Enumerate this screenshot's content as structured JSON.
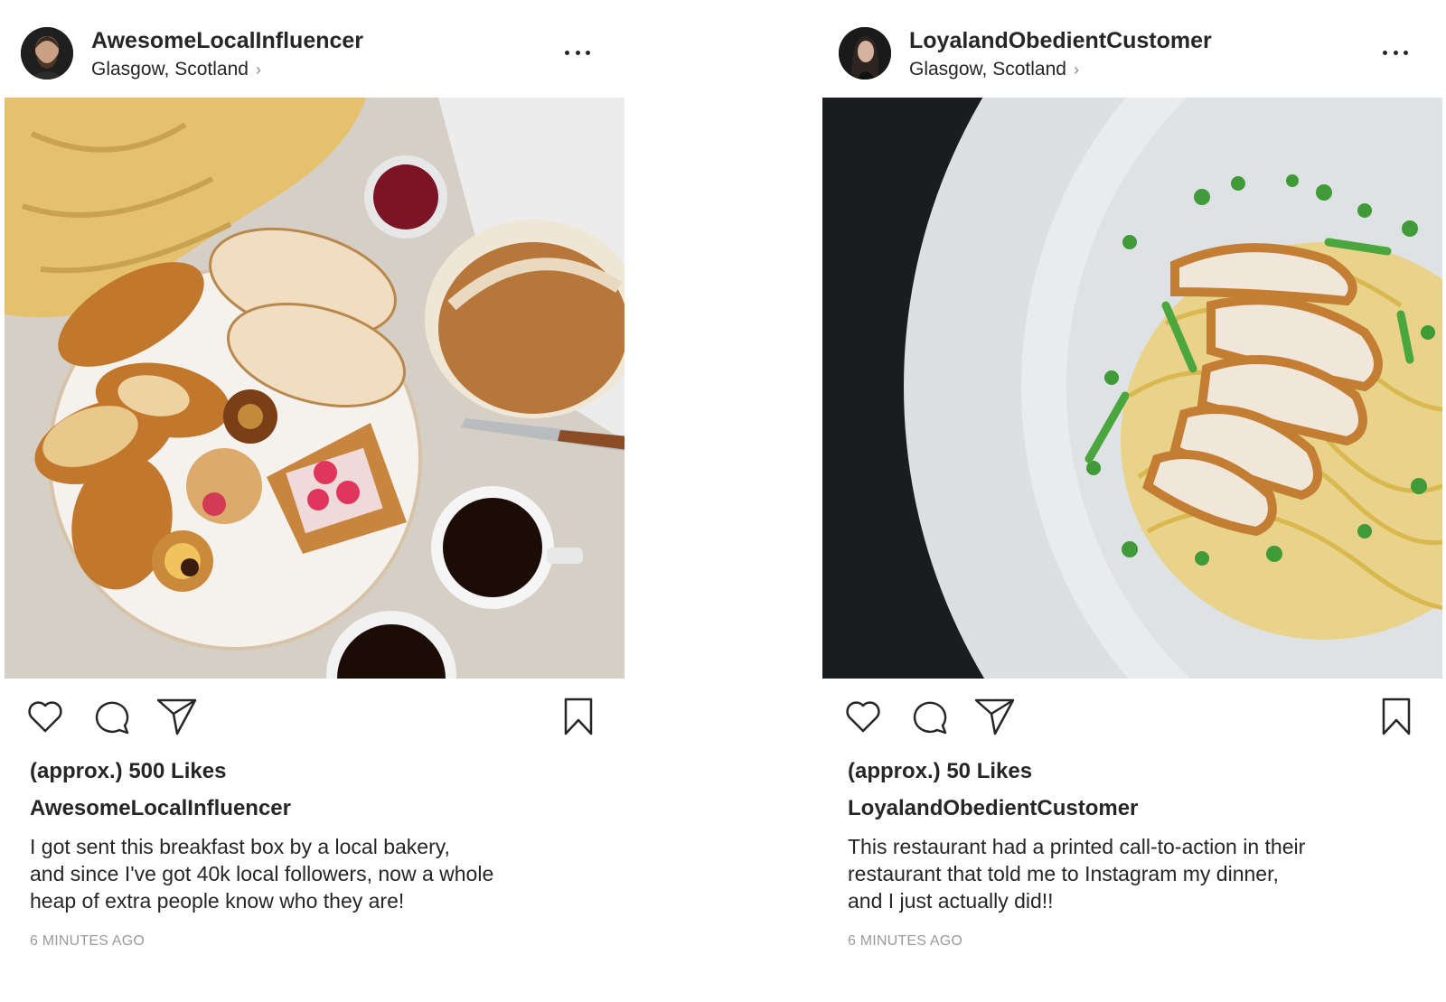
{
  "posts": [
    {
      "username": "AwesomeLocalInfluencer",
      "location": "Glasgow, Scotland",
      "likes": "(approx.) 500 Likes",
      "caption_username": "AwesomeLocalInfluencer",
      "caption_lines": [
        "I got sent this breakfast box by a local bakery,",
        "and since I've got 40k local followers, now a whole",
        "heap of extra people know who they are!"
      ],
      "timestamp": "6 MINUTES AGO",
      "photo_subject": "bakery breakfast spread with croissants, bread, pastries and coffee",
      "icons": [
        "more-options-icon",
        "heart-icon",
        "comment-icon",
        "share-icon",
        "bookmark-icon",
        "chevron-right-icon"
      ]
    },
    {
      "username": "LoyalandObedientCustomer",
      "location": "Glasgow, Scotland",
      "likes": "(approx.) 50 Likes",
      "caption_username": "LoyalandObedientCustomer",
      "caption_lines": [
        "This restaurant had a printed call-to-action in their",
        "restaurant that told me to Instagram my dinner,",
        "and I just actually did!!"
      ],
      "timestamp": "6 MINUTES AGO",
      "photo_subject": "plate of pasta with sliced chicken and peas",
      "icons": [
        "more-options-icon",
        "heart-icon",
        "comment-icon",
        "share-icon",
        "bookmark-icon",
        "chevron-right-icon"
      ]
    }
  ],
  "colors": {
    "text": "#262626",
    "secondary_text": "#9a9a9a",
    "background": "#ffffff"
  }
}
